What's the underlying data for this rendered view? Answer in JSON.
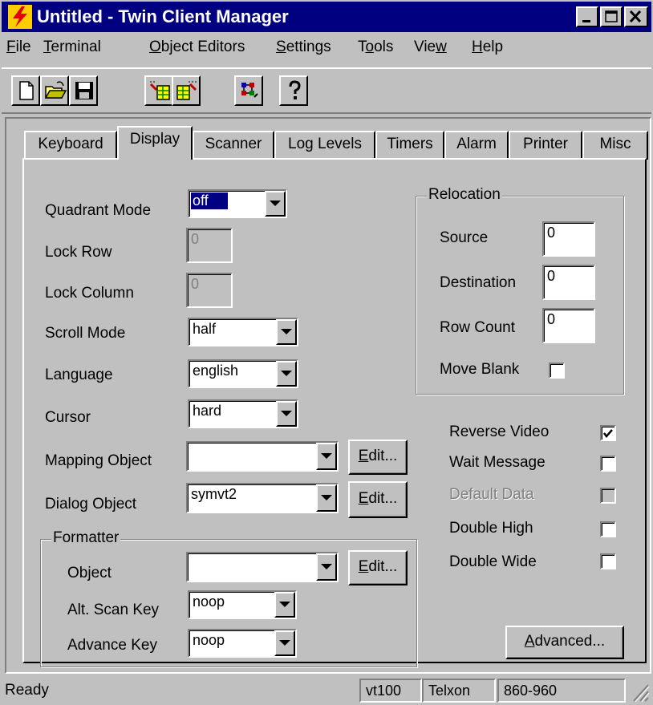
{
  "window": {
    "title": "Untitled - Twin Client Manager"
  },
  "menu": {
    "items": [
      {
        "mnemonic": "F",
        "rest": "ile"
      },
      {
        "mnemonic": "T",
        "rest": "erminal"
      },
      {
        "mnemonic": "O",
        "rest": "bject Editors"
      },
      {
        "mnemonic": "S",
        "rest": "ettings"
      },
      {
        "pre": "T",
        "mnemonic": "o",
        "rest": "ols"
      },
      {
        "pre": "Vie",
        "mnemonic": "w",
        "rest": ""
      },
      {
        "mnemonic": "H",
        "rest": "elp"
      }
    ]
  },
  "toolbar": {
    "icons": [
      "new-icon",
      "open-icon",
      "save-icon",
      "object-in-icon",
      "object-out-icon",
      "mapping-icon",
      "help-icon"
    ]
  },
  "tabs": [
    "Keyboard",
    "Display",
    "Scanner",
    "Log Levels",
    "Timers",
    "Alarm",
    "Printer",
    "Misc"
  ],
  "active_tab": "Display",
  "display": {
    "quadrant_mode": {
      "label": "Quadrant Mode",
      "value": "off"
    },
    "lock_row": {
      "label": "Lock Row",
      "value": "0"
    },
    "lock_column": {
      "label": "Lock Column",
      "value": "0"
    },
    "scroll_mode": {
      "label": "Scroll Mode",
      "value": "half"
    },
    "language": {
      "label": "Language",
      "value": "english"
    },
    "cursor": {
      "label": "Cursor",
      "value": "hard"
    },
    "mapping_object": {
      "label": "Mapping Object",
      "value": "",
      "edit_mnemonic": "E",
      "edit_rest": "dit..."
    },
    "dialog_object": {
      "label": "Dialog Object",
      "value": "symvt2",
      "edit_mnemonic": "E",
      "edit_rest": "dit..."
    },
    "formatter": {
      "group_label": "Formatter",
      "object": {
        "label": "Object",
        "value": "",
        "edit_mnemonic": "E",
        "edit_rest": "dit..."
      },
      "alt_scan_key": {
        "label": "Alt. Scan Key",
        "value": "noop"
      },
      "advance_key": {
        "label": "Advance Key",
        "value": "noop"
      }
    },
    "relocation": {
      "group_label": "Relocation",
      "source": {
        "label": "Source",
        "value": "0"
      },
      "destination": {
        "label": "Destination",
        "value": "0"
      },
      "row_count": {
        "label": "Row Count",
        "value": "0"
      },
      "move_blank": {
        "label": "Move Blank",
        "checked": false
      }
    },
    "options": [
      {
        "label": "Reverse Video",
        "checked": true,
        "enabled": true
      },
      {
        "label": "Wait Message",
        "checked": false,
        "enabled": true
      },
      {
        "label": "Default Data",
        "checked": false,
        "enabled": false
      },
      {
        "label": "Double High",
        "checked": false,
        "enabled": true
      },
      {
        "label": "Double Wide",
        "checked": false,
        "enabled": true
      }
    ],
    "advanced_button": {
      "mnemonic": "A",
      "rest": "dvanced..."
    }
  },
  "status": {
    "message": "Ready",
    "terminal": "vt100",
    "vendor": "Telxon",
    "model": "860-960"
  },
  "colors": {
    "titlebar": "#000080",
    "face": "#c0c0c0",
    "selection": "#000080",
    "disabled_text": "#808080"
  }
}
